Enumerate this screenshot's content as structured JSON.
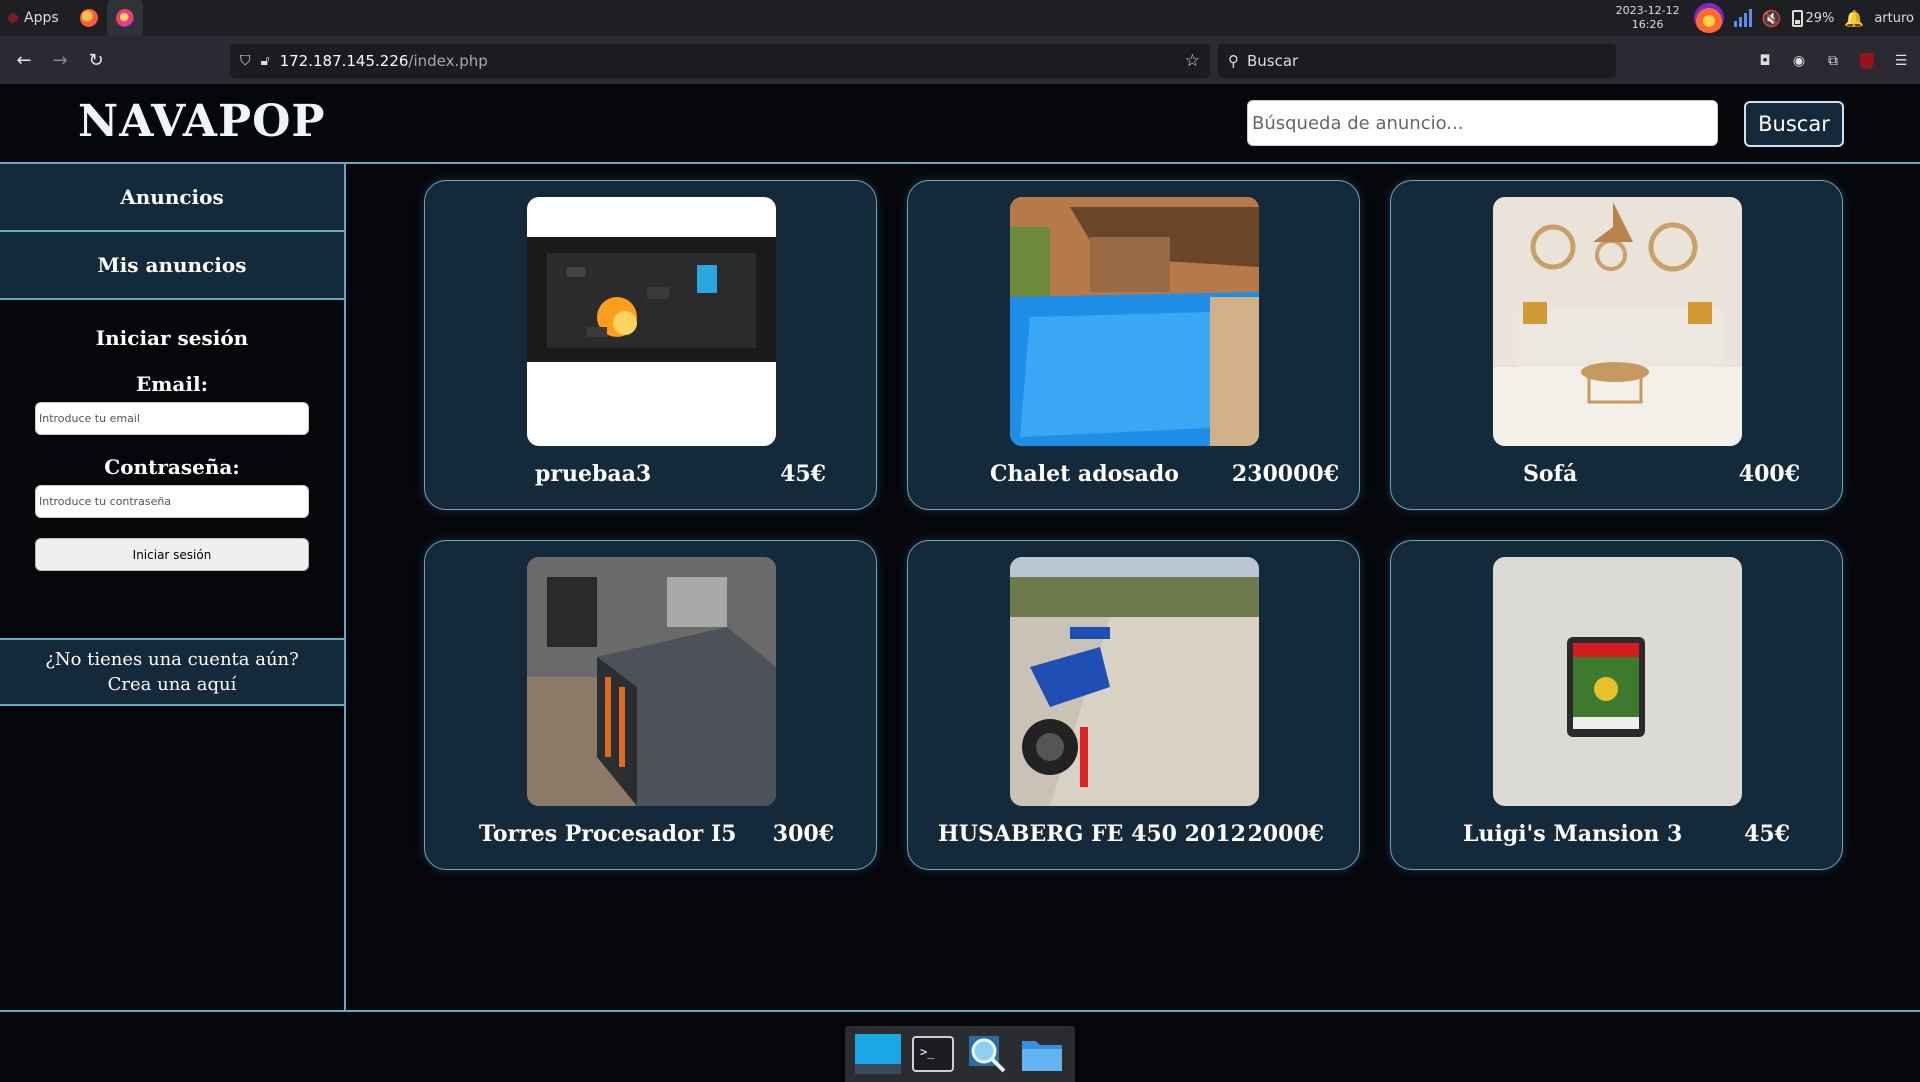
{
  "os": {
    "apps_label": "Apps",
    "date": "2023-12-12",
    "time": "16:26",
    "battery": "29%",
    "user": "arturo"
  },
  "browser": {
    "url_host": "172.187.145.226",
    "url_path": "/index.php",
    "search_placeholder": "Buscar"
  },
  "site": {
    "logo": "NAVAPOP",
    "search_placeholder": "Búsqueda de anuncio...",
    "search_button": "Buscar"
  },
  "sidebar": {
    "items": [
      {
        "label": "Anuncios"
      },
      {
        "label": "Mis anuncios"
      }
    ],
    "login": {
      "title": "Iniciar sesión",
      "email_label": "Email:",
      "email_placeholder": "Introduce tu email",
      "password_label": "Contraseña:",
      "password_placeholder": "Introduce tu contraseña",
      "submit": "Iniciar sesión"
    },
    "register": {
      "line1": "¿No tienes una cuenta aún?",
      "line2": "Crea una aquí"
    }
  },
  "listings": [
    {
      "title": "pruebaa3",
      "price": "45€"
    },
    {
      "title": "Chalet adosado",
      "price": "230000€"
    },
    {
      "title": "Sofá",
      "price": "400€"
    },
    {
      "title": "Torres Procesador I5",
      "price": "300€"
    },
    {
      "title": "HUSABERG FE 450 2012",
      "price": "2000€"
    },
    {
      "title": "Luigi's Mansion 3",
      "price": "45€"
    }
  ],
  "colors": {
    "accent_border": "#6aa6c2",
    "panel": "#14293a",
    "background": "#05070b"
  }
}
